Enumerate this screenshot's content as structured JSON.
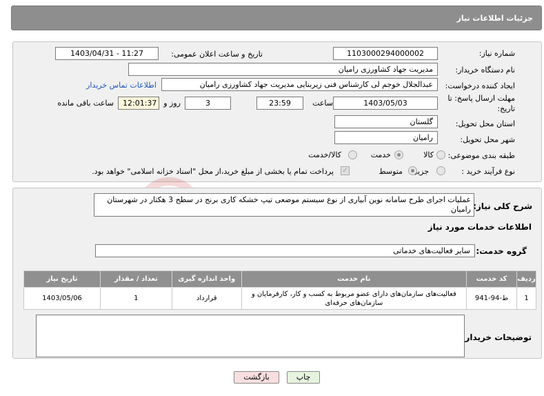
{
  "header": {
    "title": "جزئیات اطلاعات نیاز"
  },
  "form": {
    "need_number_label": "شماره نیاز:",
    "need_number": "1103000294000002",
    "announce_label": "تاریخ و ساعت اعلان عمومی:",
    "announce_value": "1403/04/31 - 11:27",
    "buyer_org_label": "نام دستگاه خریدار:",
    "buyer_org": "مدیریت جهاد کشاورزی رامیان",
    "requester_label": "ایجاد کننده درخواست:",
    "requester": "عبدالجلال خوجم لی کارشناس فنی زیربنایی مدیریت جهاد کشاورزی رامیان",
    "contact_link": "اطلاعات تماس خریدار",
    "deadline_label_1": "مهلت ارسال پاسخ: تا",
    "deadline_label_2": "تاریخ:",
    "deadline_date": "1403/05/03",
    "time_label": "ساعت",
    "deadline_time": "23:59",
    "days_value": "3",
    "days_label": "روز و",
    "remaining_time": "12:01:37",
    "remaining_label": "ساعت باقی مانده",
    "province_label": "استان محل تحویل:",
    "province": "گلستان",
    "city_label": "شهر محل تحویل:",
    "city": "رامیان",
    "category_label": "طبقه بندی موضوعی:",
    "category_options": [
      "کالا",
      "خدمت",
      "کالا/خدمت"
    ],
    "category_selected": "خدمت",
    "process_label": "نوع فرآیند خرید :",
    "process_options": [
      "جزیی",
      "متوسط"
    ],
    "process_selected": "متوسط",
    "payment_note": "پرداخت تمام یا بخشی از مبلغ خرید،از محل \"اسناد خزانه اسلامی\" خواهد بود."
  },
  "description": {
    "label": "شرح کلی نیاز:",
    "text": "عملیات اجرای طرح سامانه نوین آبیاری از نوع سیستم موضعی تیپ خشکه کاری برنج در سطح 3 هکتار در شهرستان رامیان"
  },
  "services": {
    "section_title": "اطلاعات خدمات مورد نیاز",
    "group_label": "گروه خدمت:",
    "group_value": "سایر فعالیت‌های خدماتی",
    "columns": [
      "ردیف",
      "کد خدمت",
      "نام خدمت",
      "واحد اندازه گیری",
      "تعداد / مقدار",
      "تاریخ نیاز"
    ],
    "rows": [
      [
        "1",
        "ط-94-941",
        "فعالیت‌های سازمان‌های دارای عضو مربوط به کسب و کار، کارفرمایان و سازمان‌های حرفه‌ای",
        "قرارداد",
        "1",
        "1403/05/06"
      ]
    ]
  },
  "buyer_notes": {
    "label": "توضیحات خریدار:",
    "value": ""
  },
  "buttons": {
    "print": "چاپ",
    "back": "بازگشت"
  },
  "watermark": {
    "text": "AriaTender.neT"
  },
  "colors": {
    "header_bg": "#8e8e8e",
    "panel_bg": "#f0f0f0",
    "link": "#1f56b8",
    "back_button": "#f8dede"
  }
}
